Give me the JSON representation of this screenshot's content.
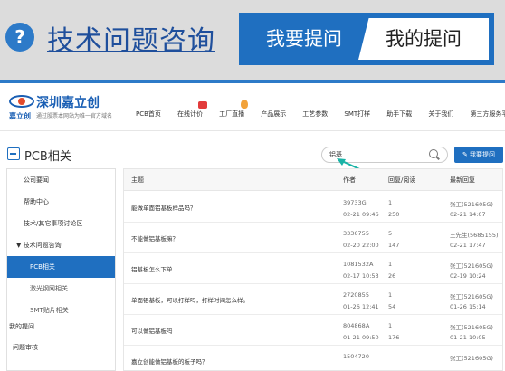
{
  "banner": {
    "help_icon": "?",
    "title": "技术问题咨询",
    "ask_tab": "我要提问",
    "mine_tab": "我的提问"
  },
  "site": {
    "logo_name": "深圳嘉立创",
    "logo_brand": "嘉立创",
    "logo_slogan": "通过股票本网站为唯一官方域名",
    "nav": [
      "PCB首页",
      "在线计价",
      "工厂直播",
      "产品展示",
      "工艺参数",
      "SMT打样",
      "助手下载",
      "关于我们",
      "第三方服务平台"
    ]
  },
  "page": {
    "section_title": "PCB相关",
    "search_value": "铝基",
    "ask_button": "我要提问"
  },
  "sidebar": {
    "items": [
      "公司要闻",
      "帮助中心",
      "技术/其它事项讨论区",
      "▼ 技术问题咨询",
      "PCB相关",
      "激光钢网相关",
      "SMT贴片相关"
    ],
    "bottom_items": [
      "我的提问",
      "问题审核"
    ]
  },
  "table": {
    "headers": [
      "主题",
      "作者",
      "回复/阅读",
      "最新回复"
    ],
    "rows": [
      {
        "topic": "能做单面铝基板样品吗？",
        "author": "39733G",
        "date": "02-21 09:46",
        "replies": "1",
        "reads": "250",
        "last_user": "张工(521605G)",
        "last_time": "02-21 14:07"
      },
      {
        "topic": "不能做铝基板嘛？",
        "author": "3336755",
        "date": "02-20 22:00",
        "replies": "5",
        "reads": "147",
        "last_user": "王先生(5685155)",
        "last_time": "02-21 17:47"
      },
      {
        "topic": "铝基板怎么下单",
        "author": "1081532A",
        "date": "02-17 10:53",
        "replies": "1",
        "reads": "26",
        "last_user": "张工(521605G)",
        "last_time": "02-19 10:24"
      },
      {
        "topic": "单面铝基板，可以打样吗，打样时间怎么样。",
        "author": "2720855",
        "date": "01-26 12:41",
        "replies": "1",
        "reads": "54",
        "last_user": "张工(521605G)",
        "last_time": "01-26 15:14"
      },
      {
        "topic": "可以做铝基板吗",
        "author": "804868A",
        "date": "01-21 09:50",
        "replies": "1",
        "reads": "176",
        "last_user": "张工(521605G)",
        "last_time": "01-21 10:05"
      },
      {
        "topic": "嘉立创能做铝基板的板子吗？",
        "author": "1504720",
        "date": "",
        "replies": "",
        "reads": "",
        "last_user": "张工(521605G)",
        "last_time": ""
      }
    ]
  }
}
